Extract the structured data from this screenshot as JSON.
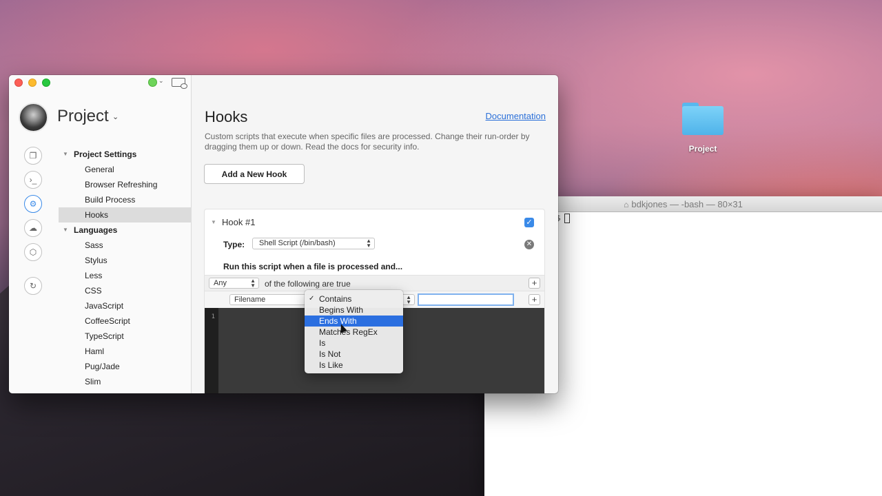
{
  "desktop": {
    "folder_label": "Project"
  },
  "terminal": {
    "title": "bdkjones — -bash — 80×31",
    "prompt_tail": "$"
  },
  "app": {
    "project_name": "Project",
    "rail_icons": [
      "files-icon",
      "terminal-icon",
      "settings-icon",
      "cloud-upload-icon",
      "package-icon",
      "history-icon"
    ],
    "tree": [
      {
        "heading": "Project Settings",
        "items": [
          "General",
          "Browser Refreshing",
          "Build Process",
          "Hooks"
        ]
      },
      {
        "heading": "Languages",
        "items": [
          "Sass",
          "Stylus",
          "Less",
          "CSS",
          "JavaScript",
          "CoffeeScript",
          "TypeScript",
          "Haml",
          "Pug/Jade",
          "Slim"
        ]
      }
    ],
    "selected_item": "Hooks",
    "main": {
      "title": "Hooks",
      "doc_link": "Documentation",
      "description": "Custom scripts that execute when specific files are processed. Change their run-order by dragging them up or down. Read the docs for security info.",
      "add_button": "Add a New Hook"
    },
    "hook": {
      "title": "Hook #1",
      "enabled": true,
      "type_label": "Type:",
      "type_value": "Shell Script (/bin/bash)",
      "run_label": "Run this script when a file is processed and...",
      "match_mode": "Any",
      "match_text": "of the following are true",
      "rule_field": "Filename",
      "rule_value": "",
      "editor_line": "1"
    },
    "menu": {
      "items": [
        "Contains",
        "Begins With",
        "Ends With",
        "Matches RegEx",
        "Is",
        "Is Not",
        "Is Like"
      ],
      "checked_index": 0,
      "highlighted_index": 2
    }
  },
  "colors": {
    "accent": "#2b6fe0",
    "link": "#2a6fd8",
    "status_green": "#6ed45a"
  }
}
